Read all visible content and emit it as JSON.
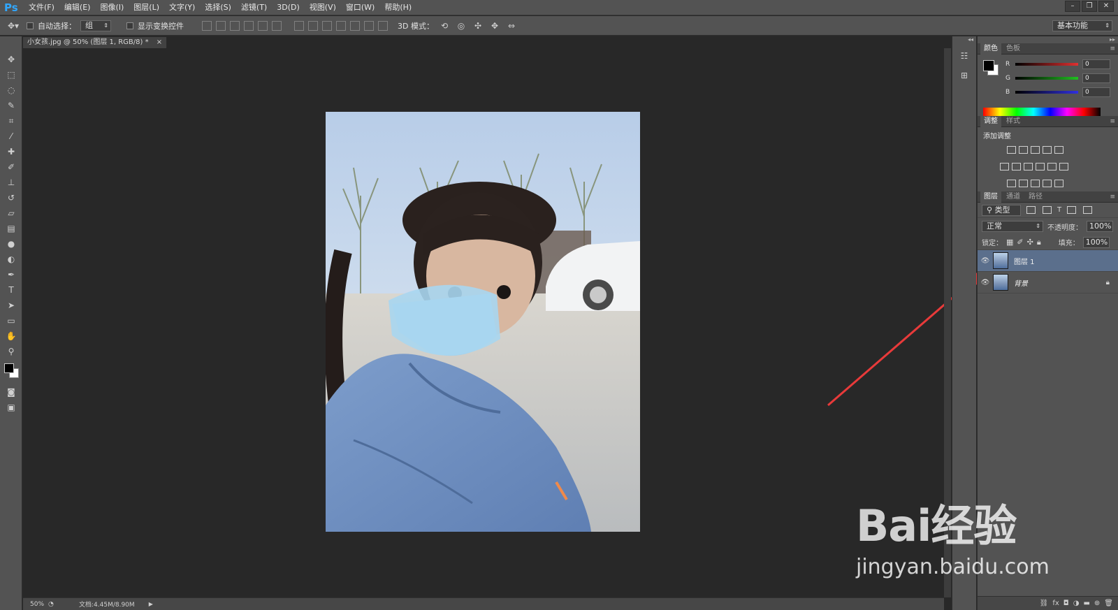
{
  "app": {
    "logo": "Ps",
    "workspace": "基本功能"
  },
  "menu": [
    "文件(F)",
    "编辑(E)",
    "图像(I)",
    "图层(L)",
    "文字(Y)",
    "选择(S)",
    "滤镜(T)",
    "3D(D)",
    "视图(V)",
    "窗口(W)",
    "帮助(H)"
  ],
  "options": {
    "auto_select": "自动选择：",
    "auto_select_value": "组",
    "show_transform": "显示变换控件",
    "mode3d": "3D 模式："
  },
  "document": {
    "tab_title": "小女孩.jpg @ 50% (图层 1, RGB/8) *",
    "zoom": "50%",
    "doc_info": "文档:4.45M/8.90M"
  },
  "panels": {
    "color": {
      "tabs": [
        "颜色",
        "色板"
      ],
      "channels": [
        {
          "label": "R",
          "value": "0",
          "color": "#e03030"
        },
        {
          "label": "G",
          "value": "0",
          "color": "#20c020"
        },
        {
          "label": "B",
          "value": "0",
          "color": "#3030e0"
        }
      ]
    },
    "adjust": {
      "tabs": [
        "调整",
        "样式"
      ],
      "title": "添加调整"
    },
    "layers": {
      "tabs": [
        "图层",
        "通道",
        "路径"
      ],
      "filter_kind": "类型",
      "blend_mode": "正常",
      "opacity_label": "不透明度：",
      "opacity": "100%",
      "lock_label": "锁定：",
      "fill_label": "填充：",
      "fill": "100%",
      "items": [
        {
          "name": "图层 1",
          "selected": true
        },
        {
          "name": "背景",
          "selected": false,
          "locked": true
        }
      ]
    }
  },
  "watermark": {
    "logo_text": "Bai经验",
    "url": "jingyan.baidu.com"
  },
  "colors": {
    "accent_ps": "#31a8ff",
    "selection": "#5b6f8c",
    "arrow": "#e83a3a"
  }
}
